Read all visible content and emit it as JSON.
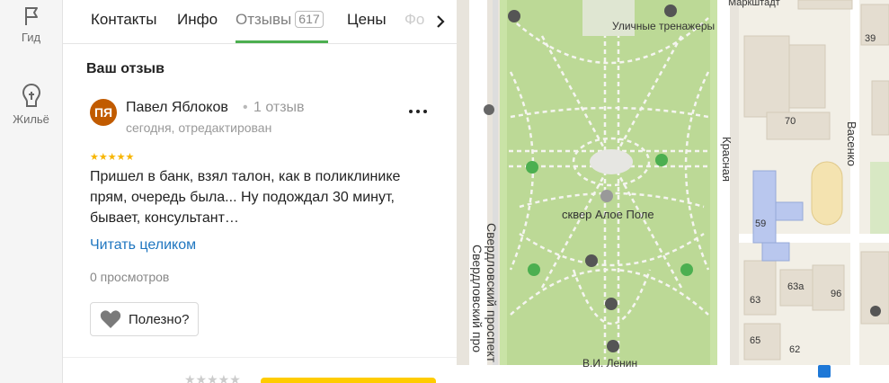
{
  "rail": {
    "items": [
      {
        "label": "Гид",
        "icon": "flag-icon"
      },
      {
        "label": "Жильё",
        "icon": "house-icon"
      }
    ]
  },
  "tabs": {
    "items": [
      {
        "label": "Контакты"
      },
      {
        "label": "Инфо"
      },
      {
        "label": "Отзывы",
        "count": "617",
        "active": true
      },
      {
        "label": "Цены"
      },
      {
        "label": "Фо"
      }
    ]
  },
  "review": {
    "section_title": "Ваш отзыв",
    "avatar_initials": "ПЯ",
    "author": "Павел Яблоков",
    "review_count": "1 отзыв",
    "date": "сегодня, отредактирован",
    "rating": 5,
    "text": "Пришел в банк, взял талон, как в поликлинике прям, очередь была... Ну подождал 30 минут, бывает, консультант…",
    "read_more": "Читать целиком",
    "views": "0 просмотров",
    "useful_label": "Полезно?"
  },
  "map": {
    "labels": {
      "top_street": "Маркштадт",
      "fitness": "Уличные тренажеры",
      "park": "сквер Алое Поле",
      "monument": "В.И. Ленин",
      "street_right": "Красная",
      "street_far_right": "Васенко",
      "prospekt_1": "Свердловский проспект",
      "prospekt_2": "Свердловский про",
      "b39": "39",
      "b70": "70",
      "b59": "59",
      "b63a": "63а",
      "b63": "63",
      "b96": "96",
      "b65": "65",
      "b62": "62"
    },
    "colors": {
      "park": "#c9e3a6",
      "road": "#ffffff",
      "building": "#e4ddd0",
      "school": "#b9c7ee"
    }
  }
}
